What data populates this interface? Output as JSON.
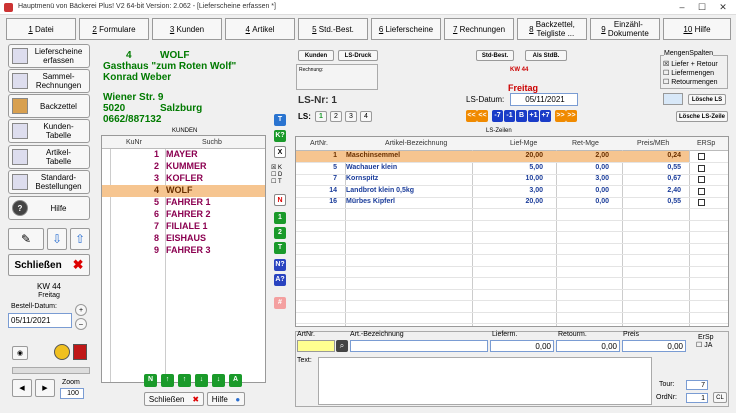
{
  "window": {
    "title": "Hauptmenü von Bäckerei Plus! V2 64-bit Version: 2.062 - [Lieferscheine erfassen *]"
  },
  "menu": [
    {
      "num": "1",
      "label": "Datei"
    },
    {
      "num": "2",
      "label": "Formulare"
    },
    {
      "num": "3",
      "label": "Kunden"
    },
    {
      "num": "4",
      "label": "Artikel"
    },
    {
      "num": "5",
      "label": "Std.-Best."
    },
    {
      "num": "6",
      "label": "Lieferscheine"
    },
    {
      "num": "7",
      "label": "Rechnungen"
    },
    {
      "num": "8",
      "label": "Backzettel,\nTeigliste ..."
    },
    {
      "num": "9",
      "label": "Einzähl-\nDokumente"
    },
    {
      "num": "10",
      "label": "Hilfe"
    }
  ],
  "sidebar": [
    {
      "label": "Lieferscheine\nerfassen"
    },
    {
      "label": "Sammel-\nRechnungen"
    },
    {
      "label": "Backzettel"
    },
    {
      "label": "Kunden-\nTabelle"
    },
    {
      "label": "Artikel-\nTabelle"
    },
    {
      "label": "Standard-\nBestellungen"
    },
    {
      "label": "Hilfe"
    }
  ],
  "schliessen": "Schließen",
  "kw": "KW 44",
  "weekday": "Freitag",
  "bestell_label": "Bestell-Datum:",
  "bestell_datum": "05/11/2021",
  "zoom_label": "Zoom",
  "zoom_value": "100",
  "customer": {
    "nr": "4",
    "kurz": "WOLF",
    "name": "Gasthaus \"zum Roten Wolf\"",
    "person": "Konrad Weber",
    "street": "Wiener Str. 9",
    "plz": "5020",
    "city": "Salzburg",
    "phone": "0662/887132"
  },
  "kunden": {
    "title": "KUNDEN",
    "col_nr": "KuNr",
    "col_such": "Suchb",
    "rows": [
      {
        "nr": "1",
        "name": "MAYER"
      },
      {
        "nr": "2",
        "name": "KUMMER"
      },
      {
        "nr": "3",
        "name": "KOFLER"
      },
      {
        "nr": "4",
        "name": "WOLF"
      },
      {
        "nr": "5",
        "name": "FAHRER 1"
      },
      {
        "nr": "6",
        "name": "FAHRER 2"
      },
      {
        "nr": "7",
        "name": "FILIALE 1"
      },
      {
        "nr": "8",
        "name": "EISHAUS"
      },
      {
        "nr": "9",
        "name": "FAHRER 3"
      }
    ]
  },
  "filter_buttons": [
    "T",
    "K?",
    "X",
    "N",
    "1",
    "2",
    "T",
    "N?",
    "A?",
    "#"
  ],
  "kdt": [
    "K",
    "D",
    "T"
  ],
  "nav_buttons": [
    "N",
    "↑",
    "↑",
    "↓",
    "↓",
    "A"
  ],
  "bottom": {
    "schliessen": "Schließen",
    "hilfe": "Hilfe"
  },
  "ls": {
    "kunden_btn": "Kunden",
    "lsdruck_btn": "LS-Druck",
    "stdbest_btn": "Std-Best.",
    "alsstdb_btn": "Als StdB.",
    "rechnung_label": "Rechnung:",
    "kw": "KW 44",
    "weekday": "Freitag",
    "lsnr_label": "LS-Nr: 1",
    "lsdatum_label": "LS-Datum:",
    "lsdatum": "05/11/2021",
    "ls_label": "LS:",
    "ls_tabs": [
      "1",
      "2",
      "3",
      "4"
    ],
    "date_nav": [
      "<<",
      "<<",
      "-7",
      "-1",
      "B",
      "+1",
      "+7",
      ">>",
      ">>"
    ],
    "zeilen_title": "LS-Zeilen",
    "cols": [
      "ArtNr.",
      "Artikel-Bezeichnung",
      "Lief-Mge",
      "Ret-Mge",
      "Preis/MEh",
      "ERSp"
    ],
    "rows": [
      {
        "nr": "1",
        "name": "Maschinsemmel",
        "lief": "20,00",
        "ret": "2,00",
        "preis": "0,24"
      },
      {
        "nr": "5",
        "name": "Wachauer klein",
        "lief": "5,00",
        "ret": "0,00",
        "preis": "0,55"
      },
      {
        "nr": "7",
        "name": "Kornspitz",
        "lief": "10,00",
        "ret": "3,00",
        "preis": "0,67"
      },
      {
        "nr": "14",
        "name": "Landbrot klein 0,5kg",
        "lief": "3,00",
        "ret": "0,00",
        "preis": "2,40"
      },
      {
        "nr": "16",
        "name": "Mürbes Kipferl",
        "lief": "20,00",
        "ret": "0,00",
        "preis": "0,55"
      }
    ]
  },
  "mengen": {
    "title": "MengenSpalten",
    "opts": [
      "Liefer + Retour",
      "Liefermengen",
      "Retourmengen"
    ]
  },
  "loesche_ls": "Lösche LS",
  "loesche_lszeile": "Lösche LS-Zeile",
  "entry": {
    "artnr": "ArtNr.",
    "bez": "Art.-Bezeichnung",
    "lieferm": "Lieferm.",
    "retourm": "Retourm.",
    "preis": "Preis",
    "ersp": "ErSp",
    "lieferm_val": "0,00",
    "retourm_val": "0,00",
    "preis_val": "0,00",
    "ja": "JA",
    "text_label": "Text:"
  },
  "tour_label": "Tour:",
  "tour_val": "7",
  "ordnr_label": "OrdNr:",
  "ordnr_val": "1",
  "cl": "CL"
}
